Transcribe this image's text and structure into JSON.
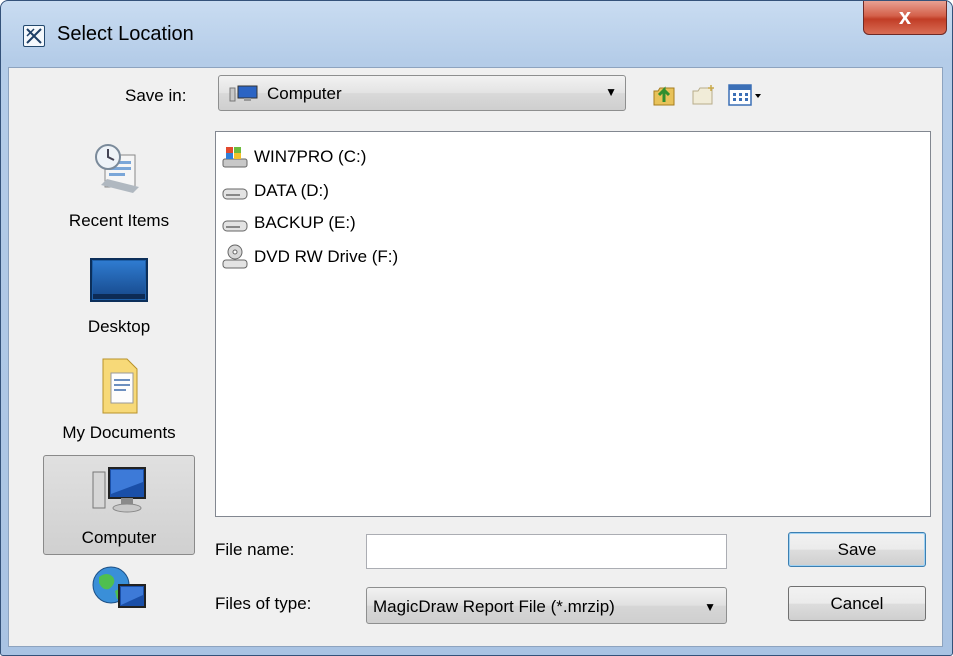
{
  "window": {
    "title": "Select Location",
    "close_glyph": "x"
  },
  "toolbar": {
    "save_in_label": "Save in:",
    "location_value": "Computer",
    "icons": [
      "up-one-level-icon",
      "create-new-folder-icon",
      "view-menu-icon"
    ]
  },
  "places": [
    {
      "label": "Recent Items",
      "icon": "recent-items-icon"
    },
    {
      "label": "Desktop",
      "icon": "desktop-icon"
    },
    {
      "label": "My Documents",
      "icon": "my-documents-icon"
    },
    {
      "label": "Computer",
      "icon": "computer-icon",
      "selected": true
    },
    {
      "label": "",
      "icon": "network-icon"
    }
  ],
  "files": [
    {
      "name": "WIN7PRO (C:)",
      "icon": "system-drive-icon"
    },
    {
      "name": "DATA (D:)",
      "icon": "hard-drive-icon"
    },
    {
      "name": "BACKUP (E:)",
      "icon": "hard-drive-icon"
    },
    {
      "name": "DVD RW Drive (F:)",
      "icon": "dvd-drive-icon"
    }
  ],
  "form": {
    "file_name_label": "File name:",
    "file_name_value": "",
    "file_type_label": "Files of type:",
    "file_type_value": "MagicDraw Report File (*.mrzip)"
  },
  "buttons": {
    "save": "Save",
    "cancel": "Cancel"
  },
  "colors": {
    "title_bar": "#b9d1ea",
    "close_button": "#c94a33",
    "default_button_border": "#3c7fb1"
  }
}
